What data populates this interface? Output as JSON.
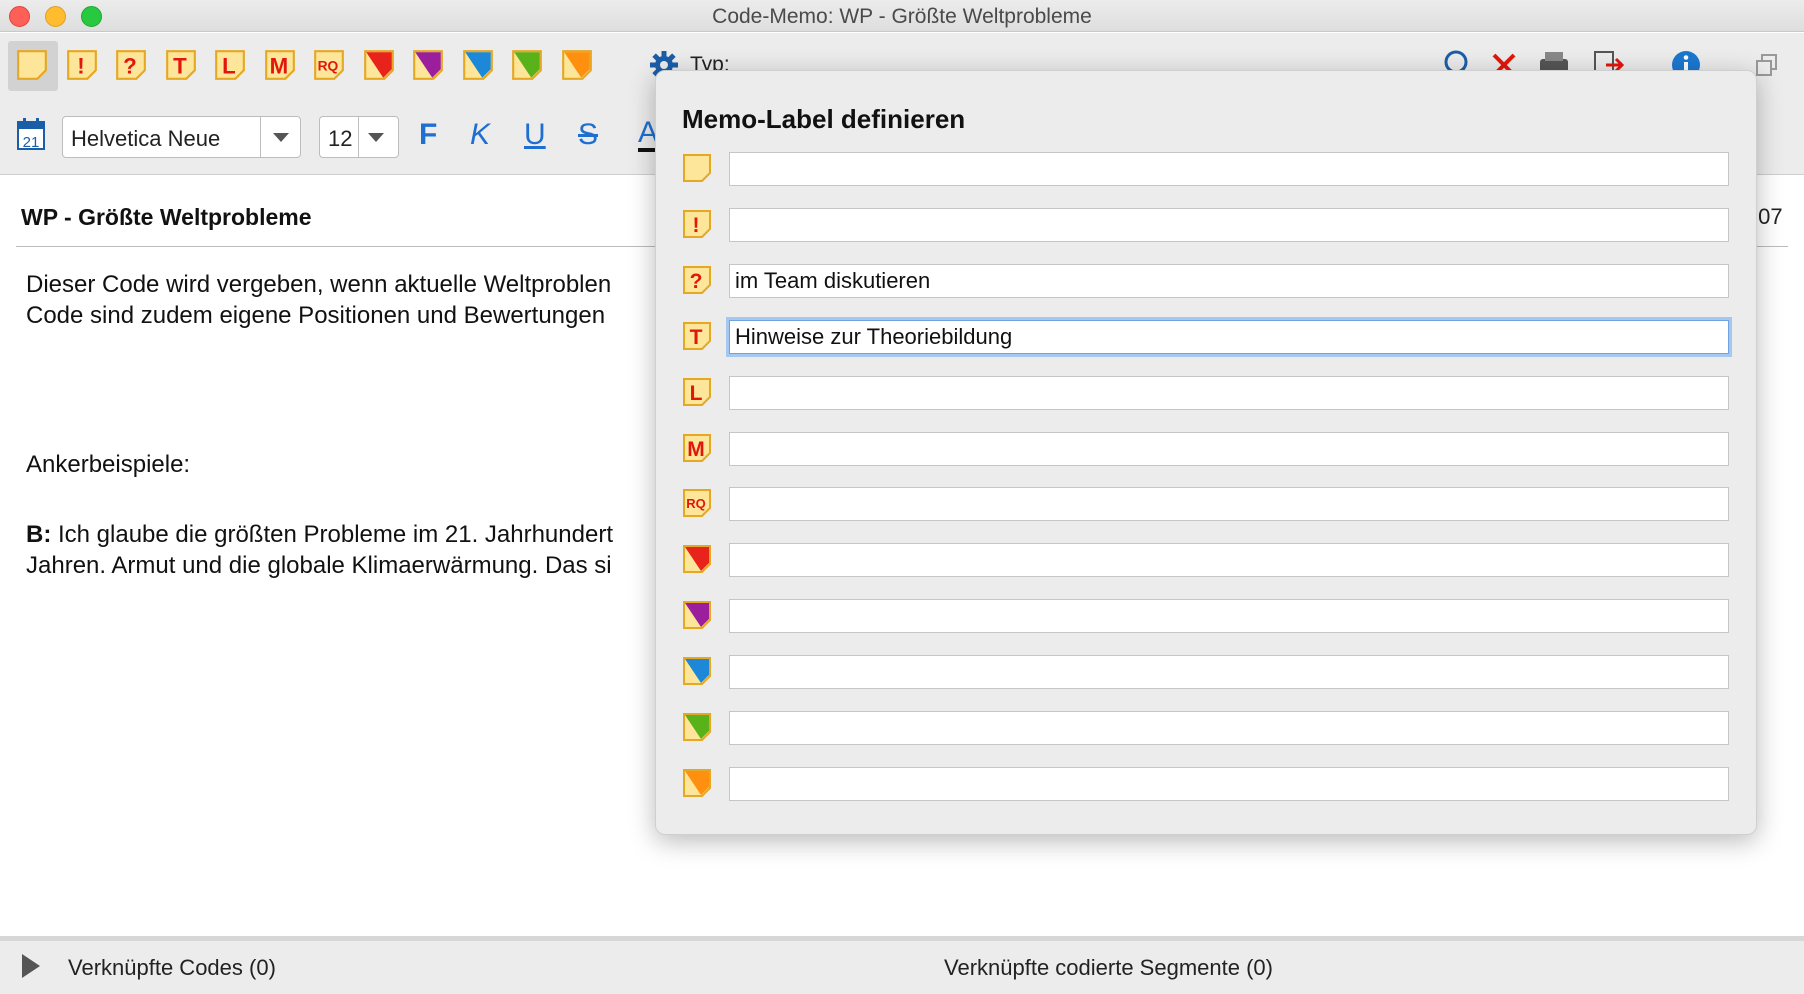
{
  "window": {
    "title": "Code-Memo: WP - Größte Weltprobleme"
  },
  "toolbar1": {
    "memo_types": [
      {
        "icon": "memo-plain-icon",
        "label": ""
      },
      {
        "icon": "memo-exclamation-icon",
        "label": "!"
      },
      {
        "icon": "memo-question-icon",
        "label": "?"
      },
      {
        "icon": "memo-t-icon",
        "label": "T"
      },
      {
        "icon": "memo-l-icon",
        "label": "L"
      },
      {
        "icon": "memo-m-icon",
        "label": "M"
      },
      {
        "icon": "memo-rq-icon",
        "label": "RQ"
      },
      {
        "icon": "memo-red-icon",
        "color": "#e8231c"
      },
      {
        "icon": "memo-purple-icon",
        "color": "#9b1e9c"
      },
      {
        "icon": "memo-blue-icon",
        "color": "#1e88d8"
      },
      {
        "icon": "memo-green-icon",
        "color": "#5ab21b"
      },
      {
        "icon": "memo-orange-icon",
        "color": "#ff8f0f"
      }
    ],
    "typ_label": "Typ:"
  },
  "toolbar2": {
    "calendar_day": "21",
    "font_family": "Helvetica Neue",
    "font_size": "12",
    "bold": "F",
    "italic": "K",
    "underline": "U",
    "strike": "S",
    "color_a": "A"
  },
  "document": {
    "title": "WP - Größte Weltprobleme",
    "time_fragment": ":07",
    "line1": "Dieser Code wird vergeben, wenn aktuelle Weltproblen",
    "line2": "Code sind zudem eigene Positionen und Bewertungen",
    "anchor_heading": "Ankerbeispiele:",
    "b_prefix": "B:",
    "b_line1": " Ich glaube die größten Probleme im 21. Jahrhundert",
    "b_line2": "Jahren. Armut und die globale Klimaerwärmung. Das si"
  },
  "bottombar": {
    "linked_codes": "Verknüpfte Codes (0)",
    "linked_segments": "Verknüpfte codierte Segmente (0)"
  },
  "popover": {
    "title": "Memo-Label definieren",
    "rows": [
      {
        "icon": "memo-plain-icon",
        "glyph": "",
        "value": ""
      },
      {
        "icon": "memo-exclamation-icon",
        "glyph": "!",
        "value": ""
      },
      {
        "icon": "memo-question-icon",
        "glyph": "?",
        "value": "im Team diskutieren"
      },
      {
        "icon": "memo-t-icon",
        "glyph": "T",
        "value": "Hinweise zur Theoriebildung"
      },
      {
        "icon": "memo-l-icon",
        "glyph": "L",
        "value": ""
      },
      {
        "icon": "memo-m-icon",
        "glyph": "M",
        "value": ""
      },
      {
        "icon": "memo-rq-icon",
        "glyph": "RQ",
        "value": ""
      },
      {
        "icon": "memo-red-icon",
        "color": "#e8231c",
        "value": ""
      },
      {
        "icon": "memo-purple-icon",
        "color": "#9b1e9c",
        "value": ""
      },
      {
        "icon": "memo-blue-icon",
        "color": "#1e88d8",
        "value": ""
      },
      {
        "icon": "memo-green-icon",
        "color": "#5ab21b",
        "value": ""
      },
      {
        "icon": "memo-orange-icon",
        "color": "#ff8f0f",
        "value": ""
      }
    ]
  },
  "colors": {
    "memo_yellow": "#fde59a",
    "memo_border": "#e5a823",
    "memo_letter": "#e3160b",
    "accent_blue": "#1f6fd1",
    "gear_blue": "#1b5ea8"
  }
}
